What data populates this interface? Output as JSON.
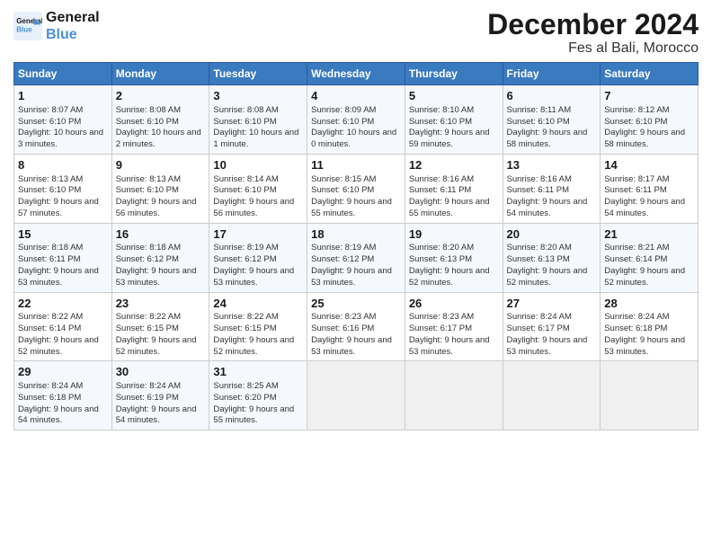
{
  "logo": {
    "line1": "General",
    "line2": "Blue"
  },
  "title": "December 2024",
  "subtitle": "Fes al Bali, Morocco",
  "days_of_week": [
    "Sunday",
    "Monday",
    "Tuesday",
    "Wednesday",
    "Thursday",
    "Friday",
    "Saturday"
  ],
  "weeks": [
    [
      {
        "day": "1",
        "sunrise": "8:07 AM",
        "sunset": "6:10 PM",
        "daylight": "10 hours and 3 minutes."
      },
      {
        "day": "2",
        "sunrise": "8:08 AM",
        "sunset": "6:10 PM",
        "daylight": "10 hours and 2 minutes."
      },
      {
        "day": "3",
        "sunrise": "8:08 AM",
        "sunset": "6:10 PM",
        "daylight": "10 hours and 1 minute."
      },
      {
        "day": "4",
        "sunrise": "8:09 AM",
        "sunset": "6:10 PM",
        "daylight": "10 hours and 0 minutes."
      },
      {
        "day": "5",
        "sunrise": "8:10 AM",
        "sunset": "6:10 PM",
        "daylight": "9 hours and 59 minutes."
      },
      {
        "day": "6",
        "sunrise": "8:11 AM",
        "sunset": "6:10 PM",
        "daylight": "9 hours and 58 minutes."
      },
      {
        "day": "7",
        "sunrise": "8:12 AM",
        "sunset": "6:10 PM",
        "daylight": "9 hours and 58 minutes."
      }
    ],
    [
      {
        "day": "8",
        "sunrise": "8:13 AM",
        "sunset": "6:10 PM",
        "daylight": "9 hours and 57 minutes."
      },
      {
        "day": "9",
        "sunrise": "8:13 AM",
        "sunset": "6:10 PM",
        "daylight": "9 hours and 56 minutes."
      },
      {
        "day": "10",
        "sunrise": "8:14 AM",
        "sunset": "6:10 PM",
        "daylight": "9 hours and 56 minutes."
      },
      {
        "day": "11",
        "sunrise": "8:15 AM",
        "sunset": "6:10 PM",
        "daylight": "9 hours and 55 minutes."
      },
      {
        "day": "12",
        "sunrise": "8:16 AM",
        "sunset": "6:11 PM",
        "daylight": "9 hours and 55 minutes."
      },
      {
        "day": "13",
        "sunrise": "8:16 AM",
        "sunset": "6:11 PM",
        "daylight": "9 hours and 54 minutes."
      },
      {
        "day": "14",
        "sunrise": "8:17 AM",
        "sunset": "6:11 PM",
        "daylight": "9 hours and 54 minutes."
      }
    ],
    [
      {
        "day": "15",
        "sunrise": "8:18 AM",
        "sunset": "6:11 PM",
        "daylight": "9 hours and 53 minutes."
      },
      {
        "day": "16",
        "sunrise": "8:18 AM",
        "sunset": "6:12 PM",
        "daylight": "9 hours and 53 minutes."
      },
      {
        "day": "17",
        "sunrise": "8:19 AM",
        "sunset": "6:12 PM",
        "daylight": "9 hours and 53 minutes."
      },
      {
        "day": "18",
        "sunrise": "8:19 AM",
        "sunset": "6:12 PM",
        "daylight": "9 hours and 53 minutes."
      },
      {
        "day": "19",
        "sunrise": "8:20 AM",
        "sunset": "6:13 PM",
        "daylight": "9 hours and 52 minutes."
      },
      {
        "day": "20",
        "sunrise": "8:20 AM",
        "sunset": "6:13 PM",
        "daylight": "9 hours and 52 minutes."
      },
      {
        "day": "21",
        "sunrise": "8:21 AM",
        "sunset": "6:14 PM",
        "daylight": "9 hours and 52 minutes."
      }
    ],
    [
      {
        "day": "22",
        "sunrise": "8:22 AM",
        "sunset": "6:14 PM",
        "daylight": "9 hours and 52 minutes."
      },
      {
        "day": "23",
        "sunrise": "8:22 AM",
        "sunset": "6:15 PM",
        "daylight": "9 hours and 52 minutes."
      },
      {
        "day": "24",
        "sunrise": "8:22 AM",
        "sunset": "6:15 PM",
        "daylight": "9 hours and 52 minutes."
      },
      {
        "day": "25",
        "sunrise": "8:23 AM",
        "sunset": "6:16 PM",
        "daylight": "9 hours and 53 minutes."
      },
      {
        "day": "26",
        "sunrise": "8:23 AM",
        "sunset": "6:17 PM",
        "daylight": "9 hours and 53 minutes."
      },
      {
        "day": "27",
        "sunrise": "8:24 AM",
        "sunset": "6:17 PM",
        "daylight": "9 hours and 53 minutes."
      },
      {
        "day": "28",
        "sunrise": "8:24 AM",
        "sunset": "6:18 PM",
        "daylight": "9 hours and 53 minutes."
      }
    ],
    [
      {
        "day": "29",
        "sunrise": "8:24 AM",
        "sunset": "6:18 PM",
        "daylight": "9 hours and 54 minutes."
      },
      {
        "day": "30",
        "sunrise": "8:24 AM",
        "sunset": "6:19 PM",
        "daylight": "9 hours and 54 minutes."
      },
      {
        "day": "31",
        "sunrise": "8:25 AM",
        "sunset": "6:20 PM",
        "daylight": "9 hours and 55 minutes."
      },
      null,
      null,
      null,
      null
    ]
  ],
  "labels": {
    "sunrise": "Sunrise:",
    "sunset": "Sunset:",
    "daylight": "Daylight:"
  }
}
